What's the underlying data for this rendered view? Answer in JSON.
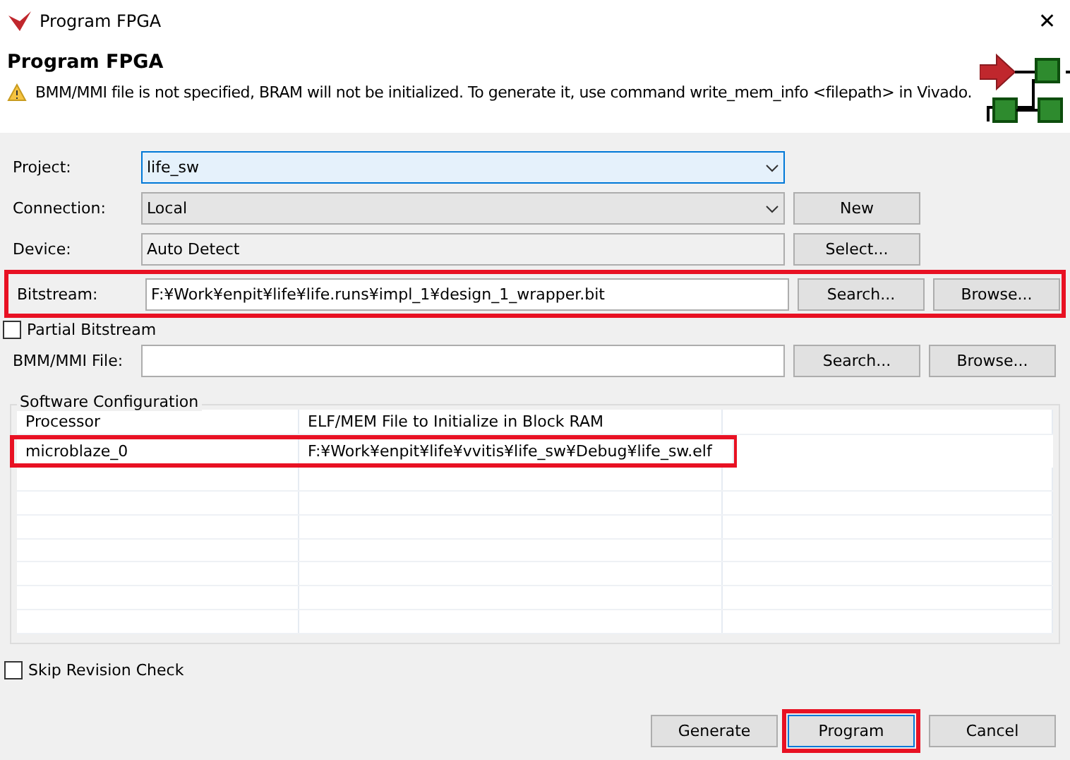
{
  "window": {
    "title": "Program FPGA",
    "close": "✕"
  },
  "header": {
    "title": "Program FPGA",
    "warning": "BMM/MMI file is not specified, BRAM will not be initialized. To generate it, use command write_mem_info <filepath> in Vivado."
  },
  "form": [
    {
      "kind": "combo",
      "label": "Project:",
      "value": "life_sw",
      "focused": true,
      "highlighted": false
    },
    {
      "kind": "combo",
      "label": "Connection:",
      "value": "Local",
      "focused": false,
      "highlighted": false,
      "buttons": [
        "New"
      ]
    },
    {
      "kind": "readonly",
      "label": "Device:",
      "value": "Auto Detect",
      "focused": false,
      "highlighted": false,
      "buttons": [
        "Select..."
      ]
    },
    {
      "kind": "text",
      "label": "Bitstream:",
      "value": "F:¥Work¥enpit¥life¥life.runs¥impl_1¥design_1_wrapper.bit",
      "focused": false,
      "highlighted": true,
      "buttons": [
        "Search...",
        "Browse..."
      ]
    },
    {
      "kind": "check",
      "label": "Partial Bitstream",
      "checked": false
    },
    {
      "kind": "text",
      "label": "BMM/MMI File:",
      "focused": false,
      "highlighted": false,
      "buttons": [
        "Search...",
        "Browse..."
      ]
    }
  ],
  "software_configuration": {
    "title": "Software Configuration",
    "columns": [
      "Processor",
      "ELF/MEM File to Initialize in Block RAM"
    ],
    "rows": [
      {
        "cells": [
          "microblaze_0",
          "F:¥Work¥enpit¥life¥vvitis¥life_sw¥Debug¥life_sw.elf"
        ],
        "highlighted": true
      }
    ]
  },
  "skip_revision_check": {
    "label": "Skip Revision Check",
    "checked": false
  },
  "buttons": [
    {
      "label": "Generate",
      "default": false,
      "highlighted": false
    },
    {
      "label": "Program",
      "default": true,
      "highlighted": true
    },
    {
      "label": "Cancel",
      "default": false,
      "highlighted": false
    }
  ]
}
